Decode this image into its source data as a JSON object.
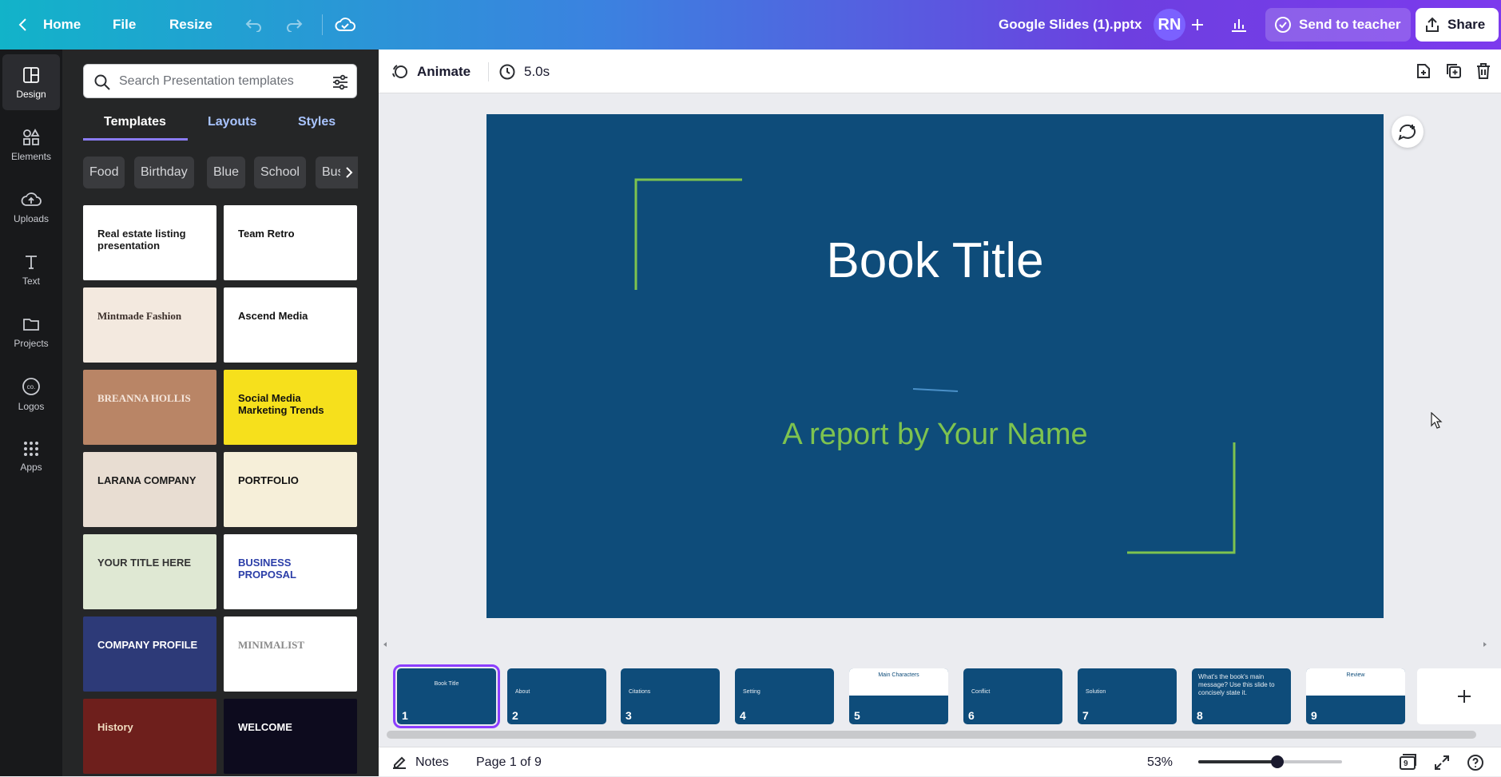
{
  "topbar": {
    "home": "Home",
    "file": "File",
    "resize": "Resize",
    "doc_title": "Google Slides (1).pptx",
    "avatar": "RN",
    "send": "Send to teacher",
    "share": "Share"
  },
  "rail": {
    "items": [
      {
        "label": "Design",
        "icon": "design-icon"
      },
      {
        "label": "Elements",
        "icon": "elements-icon"
      },
      {
        "label": "Uploads",
        "icon": "uploads-icon"
      },
      {
        "label": "Text",
        "icon": "text-icon"
      },
      {
        "label": "Projects",
        "icon": "folder-icon"
      },
      {
        "label": "Logos",
        "icon": "logos-icon"
      },
      {
        "label": "Apps",
        "icon": "apps-icon"
      }
    ]
  },
  "panel": {
    "search_placeholder": "Search Presentation templates",
    "tabs": [
      "Templates",
      "Layouts",
      "Styles"
    ],
    "chips": [
      "Food",
      "Birthday",
      "Blue",
      "School",
      "Busi"
    ],
    "templates": [
      {
        "title": "Real estate listing presentation",
        "bg": "#ffffff",
        "fg": "#1a1a1a"
      },
      {
        "title": "Team Retro",
        "bg": "#ffffff",
        "fg": "#111111"
      },
      {
        "title": "Mintmade Fashion",
        "bg": "#f3e9df",
        "fg": "#3b2f2a"
      },
      {
        "title": "Ascend Media",
        "bg": "#ffffff",
        "fg": "#111111"
      },
      {
        "title": "BREANNA HOLLIS",
        "bg": "#b98566",
        "fg": "#f5e6dc"
      },
      {
        "title": "Social Media Marketing Trends",
        "bg": "#f6e01c",
        "fg": "#111111"
      },
      {
        "title": "LARANA COMPANY",
        "bg": "#e8ddd2",
        "fg": "#1b1b1b"
      },
      {
        "title": "PORTFOLIO",
        "bg": "#f6efd9",
        "fg": "#111111"
      },
      {
        "title": "YOUR TITLE HERE",
        "bg": "#dfe8d3",
        "fg": "#333333"
      },
      {
        "title": "BUSINESS PROPOSAL",
        "bg": "#ffffff",
        "fg": "#2b3ea8"
      },
      {
        "title": "COMPANY PROFILE",
        "bg": "#2d3a78",
        "fg": "#ffffff"
      },
      {
        "title": "MINIMALIST",
        "bg": "#ffffff",
        "fg": "#8a8a8a"
      },
      {
        "title": "History",
        "bg": "#6e1f1c",
        "fg": "#f0dcc0"
      },
      {
        "title": "WELCOME",
        "bg": "#0d0b1e",
        "fg": "#ffffff"
      }
    ]
  },
  "canvas_toolbar": {
    "animate": "Animate",
    "duration": "5.0s"
  },
  "slide": {
    "title": "Book Title",
    "subtitle": "A report by Your Name",
    "bg": "#0e4c7a",
    "accent": "#7ec34f"
  },
  "filmstrip": {
    "pages": [
      {
        "n": "1",
        "label": "Book Title"
      },
      {
        "n": "2",
        "label": "About"
      },
      {
        "n": "3",
        "label": "Citations"
      },
      {
        "n": "4",
        "label": "Setting"
      },
      {
        "n": "5",
        "label": "Main Characters"
      },
      {
        "n": "6",
        "label": "Conflict"
      },
      {
        "n": "7",
        "label": "Solution"
      },
      {
        "n": "8",
        "label": "What's the book's main message? Use this slide to concisely state it."
      },
      {
        "n": "9",
        "label": "Review"
      }
    ]
  },
  "status": {
    "notes": "Notes",
    "page": "Page 1 of 9",
    "zoom": "53%",
    "zoom_level": 0.53,
    "pages_count": "9"
  }
}
